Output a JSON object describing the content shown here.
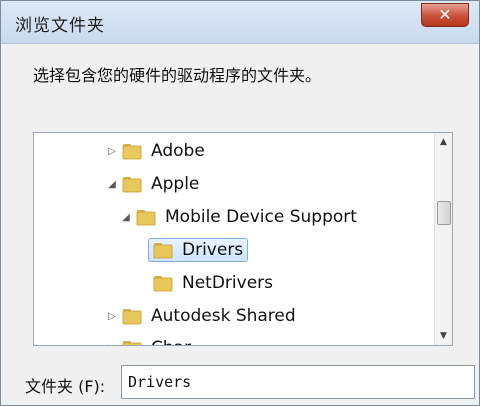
{
  "window": {
    "title": "浏览文件夹",
    "close_label": "✕"
  },
  "instruction": "选择包含您的硬件的驱动程序的文件夹。",
  "tree": {
    "items": [
      {
        "label": "Adobe"
      },
      {
        "label": "Apple"
      },
      {
        "label": "Mobile Device Support"
      },
      {
        "label": "Drivers"
      },
      {
        "label": "NetDrivers"
      },
      {
        "label": "Autodesk Shared"
      },
      {
        "label": "Char..."
      }
    ]
  },
  "folder_field": {
    "label": "文件夹 (F):",
    "value": "Drivers"
  },
  "colors": {
    "folder": "#e9c85b",
    "selection": "#cfe5fc"
  }
}
